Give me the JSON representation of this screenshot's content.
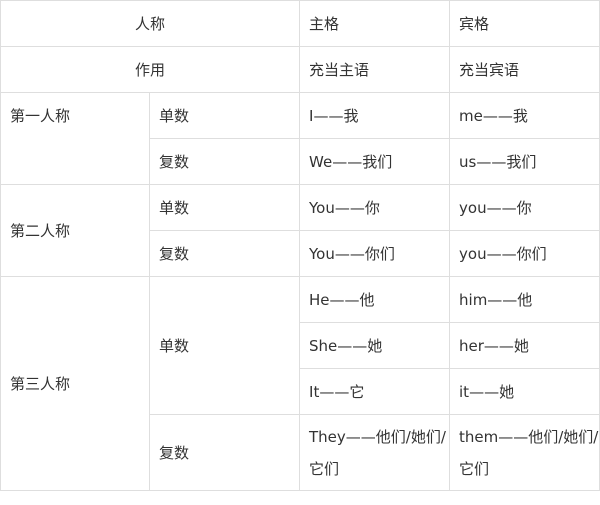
{
  "header": {
    "person_label": "人称",
    "subject_case": "主格",
    "object_case": "宾格",
    "function_label": "作用",
    "subject_function": "充当主语",
    "object_function": "充当宾语"
  },
  "groups": [
    {
      "person": "第一人称",
      "rows": [
        {
          "number": "单数",
          "subject": "I——我",
          "object": "me——我"
        },
        {
          "number": "复数",
          "subject": "We——我们",
          "object": "us——我们"
        }
      ]
    },
    {
      "person": "第二人称",
      "rows": [
        {
          "number": "单数",
          "subject": "You——你",
          "object": "you——你"
        },
        {
          "number": "复数",
          "subject": "You——你们",
          "object": "you——你们"
        }
      ]
    },
    {
      "person": "第三人称",
      "singular_label": "单数",
      "singular_rows": [
        {
          "subject": "He——他",
          "object": "him——他"
        },
        {
          "subject": "She——她",
          "object": "her——她"
        },
        {
          "subject": "It——它",
          "object": "it——她"
        }
      ],
      "plural_row": {
        "number": "复数",
        "subject": "They——他们/她们/它们",
        "object": "them——他们/她们/它们"
      }
    }
  ]
}
